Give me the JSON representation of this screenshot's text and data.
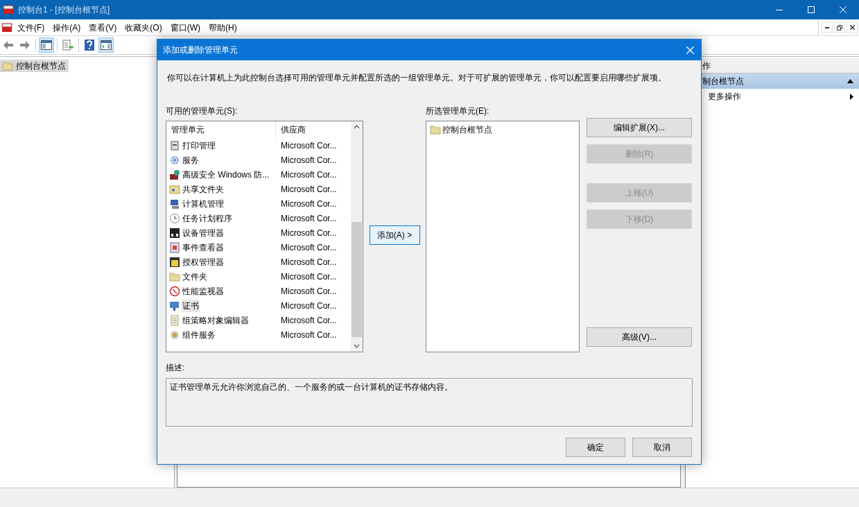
{
  "window": {
    "title": "控制台1 - [控制台根节点]"
  },
  "menu": [
    "文件(F)",
    "操作(A)",
    "查看(V)",
    "收藏夹(O)",
    "窗口(W)",
    "帮助(H)"
  ],
  "toolbar": [
    {
      "kind": "back",
      "pressed": false
    },
    {
      "kind": "forward",
      "pressed": false
    },
    {
      "kind": "tree",
      "pressed": true
    },
    {
      "kind": "export",
      "pressed": false
    },
    {
      "kind": "help",
      "pressed": false
    },
    {
      "kind": "actions",
      "pressed": true
    }
  ],
  "tree": {
    "items": [
      {
        "label": "控制台根节点",
        "selected": true
      }
    ]
  },
  "actions_pane": {
    "header": "作",
    "section": "制台根节点",
    "expanded": true,
    "items": [
      "更多操作"
    ]
  },
  "dialog": {
    "title": "添加或删除管理单元",
    "intro": "你可以在计算机上为此控制台选择可用的管理单元并配置所选的一组管理单元。对于可扩展的管理单元，你可以配置要启用哪些扩展项。",
    "available_label": "可用的管理单元(S):",
    "columns": [
      "管理单元",
      "供应商"
    ],
    "snapins": [
      {
        "name": "打印管理",
        "vendor": "Microsoft Cor...",
        "selected": false
      },
      {
        "name": "服务",
        "vendor": "Microsoft Cor...",
        "selected": false
      },
      {
        "name": "高级安全 Windows 防...",
        "vendor": "Microsoft Cor...",
        "selected": false
      },
      {
        "name": "共享文件夹",
        "vendor": "Microsoft Cor...",
        "selected": false
      },
      {
        "name": "计算机管理",
        "vendor": "Microsoft Cor...",
        "selected": false
      },
      {
        "name": "任务计划程序",
        "vendor": "Microsoft Cor...",
        "selected": false
      },
      {
        "name": "设备管理器",
        "vendor": "Microsoft Cor...",
        "selected": false
      },
      {
        "name": "事件查看器",
        "vendor": "Microsoft Cor...",
        "selected": false
      },
      {
        "name": "授权管理器",
        "vendor": "Microsoft Cor...",
        "selected": false
      },
      {
        "name": "文件夹",
        "vendor": "Microsoft Cor...",
        "selected": false
      },
      {
        "name": "性能监视器",
        "vendor": "Microsoft Cor...",
        "selected": false
      },
      {
        "name": "证书",
        "vendor": "Microsoft Cor...",
        "selected": true
      },
      {
        "name": "组策略对象编辑器",
        "vendor": "Microsoft Cor...",
        "selected": false
      },
      {
        "name": "组件服务",
        "vendor": "Microsoft Cor...",
        "selected": false
      }
    ],
    "add_button": "添加(A) >",
    "selected_label": "所选管理单元(E):",
    "selected_items": [
      {
        "label": "控制台根节点"
      }
    ],
    "side_buttons": [
      {
        "label": "编辑扩展(X)...",
        "disabled": false
      },
      {
        "label": "删除(R)",
        "disabled": true
      },
      {
        "label": "上移(U)",
        "disabled": true
      },
      {
        "label": "下移(D)",
        "disabled": true
      },
      {
        "label": "高级(V)...",
        "disabled": false
      }
    ],
    "description_label": "描述:",
    "description": "证书管理单元允许你浏览自己的、一个服务的或一台计算机的证书存储内容。",
    "buttons": [
      "确定",
      "取消"
    ]
  }
}
